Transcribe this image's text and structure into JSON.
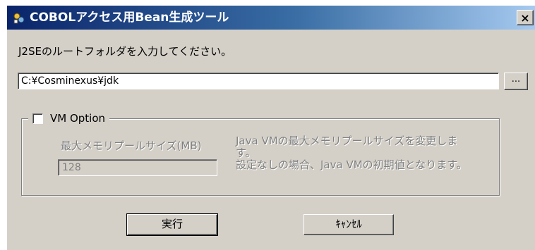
{
  "window": {
    "title": "COBOLアクセス用Bean生成ツール",
    "icon": "app-icon",
    "close_label": "×"
  },
  "prompt": "J2SEのルートフォルダを入力してください。",
  "path_input": {
    "value": "C:¥Cosminexus¥jdk",
    "browse_label": "..."
  },
  "vm_option": {
    "label": "VM Option",
    "checked": false,
    "memory_label": "最大メモリプールサイズ(MB)",
    "memory_value": "128",
    "description_lines": [
      "Java VMの最大メモリプールサイズを変更しま",
      "す。",
      "設定なしの場合、Java VMの初期値となります。"
    ]
  },
  "buttons": {
    "run": "実行",
    "cancel": "ｷｬﾝｾﾙ"
  },
  "colors": {
    "title_gradient_start": "#0a246a",
    "title_gradient_end": "#a6caf0",
    "face": "#d4d0c8",
    "disabled_text": "#808080"
  }
}
